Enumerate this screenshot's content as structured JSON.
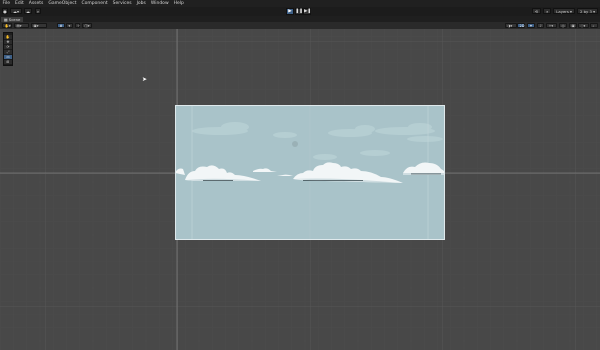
{
  "menu": [
    "File",
    "Edit",
    "Assets",
    "GameObject",
    "Component",
    "Services",
    "Jobs",
    "Window",
    "Help"
  ],
  "toolbar": {
    "play_icon": "play-icon",
    "pause_icon": "pause-icon",
    "step_icon": "step-icon",
    "layers_label": "Layers",
    "layout_label": "2 by 3"
  },
  "tabs": {
    "scene_label": "Scene"
  },
  "scene_toolbar": {
    "shading_mode": "Shaded",
    "mode_2d": "2D",
    "gizmos": "Gizmos"
  },
  "tools": [
    "view-tool",
    "move-tool",
    "rotate-tool",
    "scale-tool",
    "rect-tool",
    "transform-tool"
  ],
  "colors": {
    "sky": "#a9c3c9",
    "cloud": "#f2f6f7",
    "cloud_shade": "#cfdde1",
    "grid": "#555555",
    "accent": "#3d5f86"
  }
}
